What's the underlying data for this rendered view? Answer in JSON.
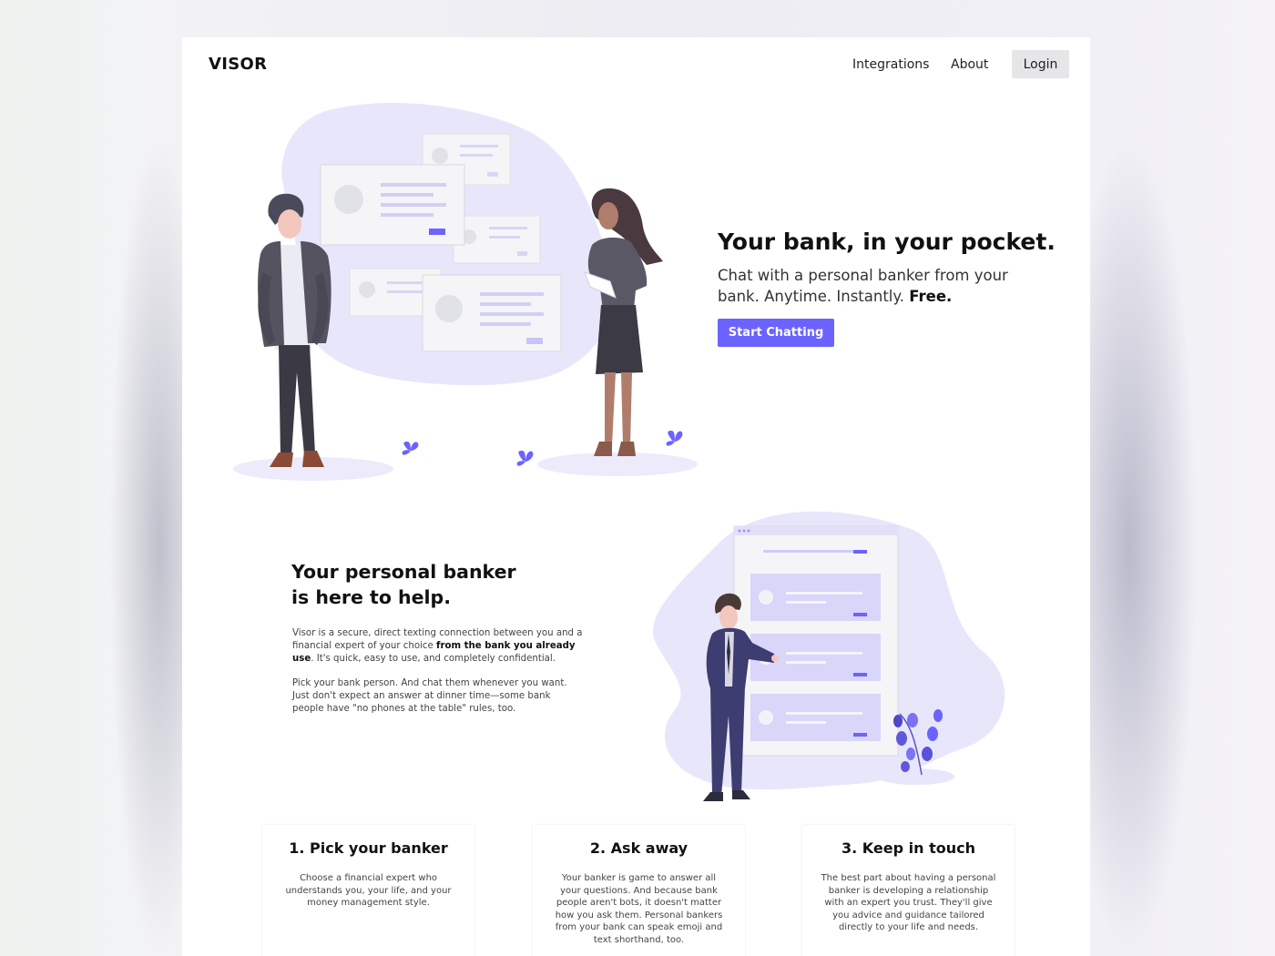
{
  "nav": {
    "logo": "VISOR",
    "links": [
      "Integrations",
      "About"
    ],
    "login": "Login"
  },
  "hero": {
    "title": "Your bank, in your pocket.",
    "subtitle_plain": "Chat with a personal banker from your bank. Anytime. Instantly.",
    "subtitle_bold": "Free.",
    "cta": "Start Chatting"
  },
  "about": {
    "title_line1": "Your personal banker",
    "title_line2": "is here to help.",
    "p1_start": "Visor is a secure, direct texting connection between you and a financial expert of your choice",
    "p1_bold": "from the bank you already use",
    "p1_end": ". It's quick, easy to use, and completely confidential.",
    "p2": "Pick your bank person. And chat them whenever you want. Just don't expect an answer at dinner time—some bank people have \"no phones at the table\" rules, too."
  },
  "steps": [
    {
      "title": "1. Pick your banker",
      "body": "Choose a financial expert who understands you, your life, and your money management style."
    },
    {
      "title": "2. Ask away",
      "body": "Your banker is game to answer all your questions. And because bank people aren't bots, it doesn't matter how you ask them. Personal bankers from your bank can speak emoji and text shorthand, too."
    },
    {
      "title": "3. Keep in touch",
      "body": "The best part about having a personal banker is developing a relationship with an expert you trust. They'll give you advice and guidance tailored directly to your life and needs."
    }
  ],
  "colors": {
    "accent": "#6c63ff",
    "blob": "#e8e6fb",
    "card_fill": "#f5f5f7",
    "list_fill": "#d9d6fa"
  },
  "icons": [
    "plant-icon",
    "leaf-sprout-icon",
    "window-dots-icon"
  ]
}
